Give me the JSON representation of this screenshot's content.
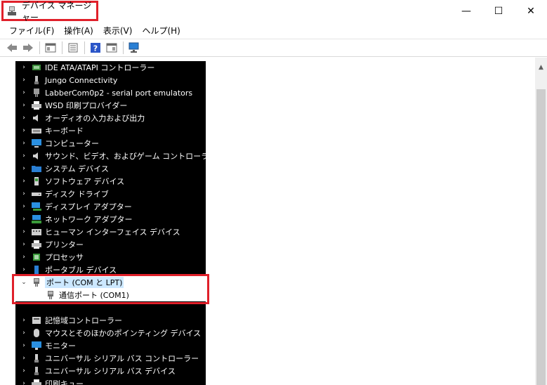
{
  "window": {
    "title": "デバイス マネージャー",
    "controls": {
      "minimize": "—",
      "maximize": "☐",
      "close": "✕"
    }
  },
  "menu": [
    {
      "label": "ファイル(F)"
    },
    {
      "label": "操作(A)"
    },
    {
      "label": "表示(V)"
    },
    {
      "label": "ヘルプ(H)"
    }
  ],
  "tree": {
    "categories": [
      {
        "label": "IDE ATA/ATAPI コントローラー",
        "icon": "ide-controller-icon"
      },
      {
        "label": "Jungo Connectivity",
        "icon": "usb-device-icon"
      },
      {
        "label": "LabberCom0p2 - serial port emulators",
        "icon": "port-plug-icon"
      },
      {
        "label": "WSD 印刷プロバイダー",
        "icon": "printer-icon"
      },
      {
        "label": "オーディオの入力および出力",
        "icon": "speaker-icon"
      },
      {
        "label": "キーボード",
        "icon": "keyboard-icon"
      },
      {
        "label": "コンピューター",
        "icon": "computer-icon"
      },
      {
        "label": "サウンド、ビデオ、およびゲーム コントローラー",
        "icon": "speaker-icon"
      },
      {
        "label": "システム デバイス",
        "icon": "folder-icon"
      },
      {
        "label": "ソフトウェア デバイス",
        "icon": "software-device-icon"
      },
      {
        "label": "ディスク ドライブ",
        "icon": "disk-drive-icon"
      },
      {
        "label": "ディスプレイ アダプター",
        "icon": "display-adapter-icon"
      },
      {
        "label": "ネットワーク アダプター",
        "icon": "network-adapter-icon"
      },
      {
        "label": "ヒューマン インターフェイス デバイス",
        "icon": "hid-icon"
      },
      {
        "label": "プリンター",
        "icon": "printer-icon"
      },
      {
        "label": "プロセッサ",
        "icon": "processor-icon"
      },
      {
        "label": "ポータブル デバイス",
        "icon": "portable-device-icon"
      }
    ],
    "ports": {
      "label": "ポート (COM と LPT)",
      "child": "通信ポート (COM1)"
    },
    "categories_after": [
      {
        "label": "記憶域コントローラー",
        "icon": "storage-controller-icon"
      },
      {
        "label": "マウスとそのほかのポインティング デバイス",
        "icon": "mouse-icon"
      },
      {
        "label": "モニター",
        "icon": "monitor-icon"
      },
      {
        "label": "ユニバーサル シリアル バス コントローラー",
        "icon": "usb-controller-icon"
      },
      {
        "label": "ユニバーサル シリアル バス デバイス",
        "icon": "usb-device-icon"
      },
      {
        "label": "印刷キュー",
        "icon": "print-queue-icon"
      }
    ]
  },
  "colors": {
    "highlight_border": "#e0202a",
    "selection": "#cce8ff",
    "tree_background": "#000000"
  }
}
